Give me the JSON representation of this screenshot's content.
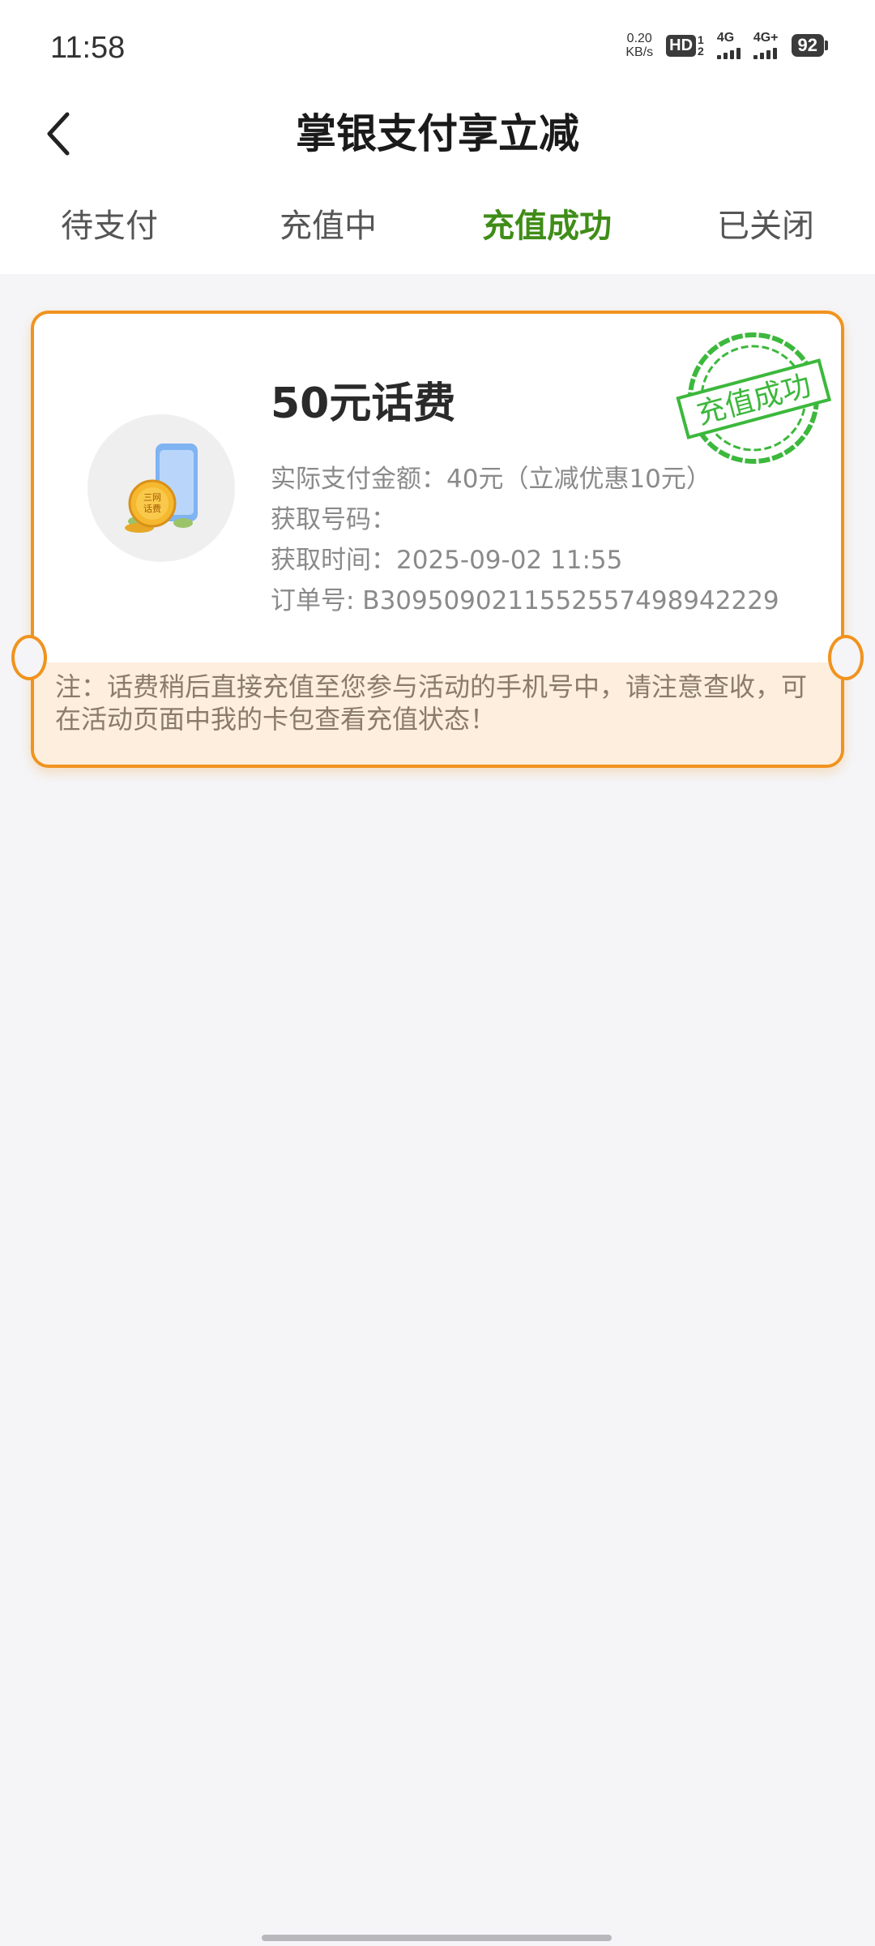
{
  "status_bar": {
    "time": "11:58",
    "net_speed_value": "0.20",
    "net_speed_unit": "KB/s",
    "hd_label": "HD",
    "hd_sub_top": "1",
    "hd_sub_bottom": "2",
    "signal1_label": "4G",
    "signal2_label": "4G+",
    "battery": "92"
  },
  "header": {
    "title": "掌银支付享立减",
    "back_icon": "chevron-left-icon"
  },
  "tabs": [
    {
      "label": "待支付",
      "active": false
    },
    {
      "label": "充值中",
      "active": false
    },
    {
      "label": "充值成功",
      "active": true
    },
    {
      "label": "已关闭",
      "active": false
    }
  ],
  "order": {
    "product_title": "50元话费",
    "icon_badge_line1": "三网",
    "icon_badge_line2": "话费",
    "paid_amount_row": "实际支付金额：40元（立减优惠10元）",
    "phone_row": "获取号码：",
    "time_row": "获取时间：2025-09-02 11:55",
    "order_no_row": "订单号: B3095090211552557498942229",
    "stamp_text": "充值成功",
    "note": "注：话费稍后直接充值至您参与活动的手机号中，请注意查收，可在活动页面中我的卡包查看充值状态！"
  },
  "colors": {
    "accent_green": "#3f8d17",
    "card_border": "#f0931e",
    "stamp_green": "#3cb83c",
    "note_bg": "#fdeedd"
  }
}
